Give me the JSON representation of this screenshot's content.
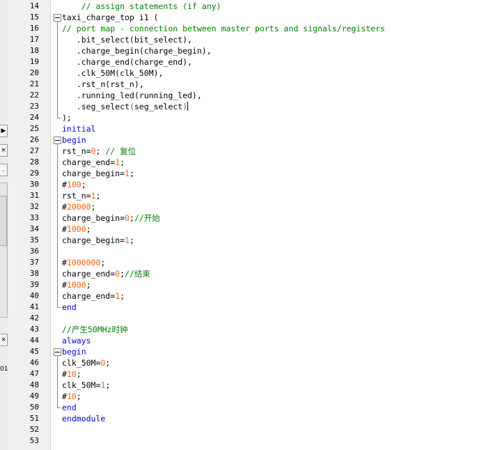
{
  "left_panel": {
    "button_arrow": "▶",
    "button_close_1": "×",
    "button_dot": ".",
    "button_close_2": "×",
    "fragment_text": "01"
  },
  "editor": {
    "lines": [
      {
        "n": "14",
        "tokens": [
          {
            "t": "    // assign statements (if any)",
            "c": "cm"
          }
        ]
      },
      {
        "n": "15",
        "fold": true,
        "tokens": [
          {
            "t": "taxi_charge_top i1 (",
            "c": "tx"
          }
        ]
      },
      {
        "n": "16",
        "tokens": [
          {
            "t": "// port map - connection between master ports and signals/registers",
            "c": "cm"
          }
        ]
      },
      {
        "n": "17",
        "tokens": [
          {
            "t": "   .bit_select(bit_select),",
            "c": "tx"
          }
        ]
      },
      {
        "n": "18",
        "tokens": [
          {
            "t": "   .charge_begin(charge_begin),",
            "c": "tx"
          }
        ]
      },
      {
        "n": "19",
        "tokens": [
          {
            "t": "   .charge_end(charge_end),",
            "c": "tx"
          }
        ]
      },
      {
        "n": "20",
        "tokens": [
          {
            "t": "   .clk_50M(clk_50M),",
            "c": "tx"
          }
        ]
      },
      {
        "n": "21",
        "tokens": [
          {
            "t": "   .rst_n(rst_n),",
            "c": "tx"
          }
        ]
      },
      {
        "n": "22",
        "tokens": [
          {
            "t": "   .running_led(running_led),",
            "c": "tx"
          }
        ]
      },
      {
        "n": "23",
        "caret": true,
        "tokens": [
          {
            "t": "   .seg_select",
            "c": "tx"
          },
          {
            "t": "(",
            "c": "pn"
          },
          {
            "t": "seg_select",
            "c": "tx"
          },
          {
            "t": ")",
            "c": "pn"
          }
        ]
      },
      {
        "n": "24",
        "tokens": [
          {
            "t": ");",
            "c": "tx"
          }
        ]
      },
      {
        "n": "25",
        "tokens": [
          {
            "t": "initial",
            "c": "kw"
          }
        ]
      },
      {
        "n": "26",
        "fold": true,
        "tokens": [
          {
            "t": "begin",
            "c": "kw"
          }
        ]
      },
      {
        "n": "27",
        "tokens": [
          {
            "t": "rst_n=",
            "c": "tx"
          },
          {
            "t": "0",
            "c": "num"
          },
          {
            "t": "; ",
            "c": "tx"
          },
          {
            "t": "// 复位",
            "c": "cm"
          }
        ]
      },
      {
        "n": "28",
        "tokens": [
          {
            "t": "charge_end=",
            "c": "tx"
          },
          {
            "t": "1",
            "c": "num"
          },
          {
            "t": ";",
            "c": "tx"
          }
        ]
      },
      {
        "n": "29",
        "tokens": [
          {
            "t": "charge_begin=",
            "c": "tx"
          },
          {
            "t": "1",
            "c": "num"
          },
          {
            "t": ";",
            "c": "tx"
          }
        ]
      },
      {
        "n": "30",
        "tokens": [
          {
            "t": "#",
            "c": "tx"
          },
          {
            "t": "100",
            "c": "num"
          },
          {
            "t": ";",
            "c": "tx"
          }
        ]
      },
      {
        "n": "31",
        "tokens": [
          {
            "t": "rst_n=",
            "c": "tx"
          },
          {
            "t": "1",
            "c": "num"
          },
          {
            "t": ";",
            "c": "tx"
          }
        ]
      },
      {
        "n": "32",
        "tokens": [
          {
            "t": "#",
            "c": "tx"
          },
          {
            "t": "20000",
            "c": "num"
          },
          {
            "t": ";",
            "c": "tx"
          }
        ]
      },
      {
        "n": "33",
        "tokens": [
          {
            "t": "charge_begin=",
            "c": "tx"
          },
          {
            "t": "0",
            "c": "num"
          },
          {
            "t": ";",
            "c": "tx"
          },
          {
            "t": "//开始",
            "c": "cm"
          }
        ]
      },
      {
        "n": "34",
        "tokens": [
          {
            "t": "#",
            "c": "tx"
          },
          {
            "t": "1000",
            "c": "num"
          },
          {
            "t": ";",
            "c": "tx"
          }
        ]
      },
      {
        "n": "35",
        "tokens": [
          {
            "t": "charge_begin=",
            "c": "tx"
          },
          {
            "t": "1",
            "c": "num"
          },
          {
            "t": ";",
            "c": "tx"
          }
        ]
      },
      {
        "n": "36",
        "tokens": []
      },
      {
        "n": "37",
        "tokens": [
          {
            "t": "#",
            "c": "tx"
          },
          {
            "t": "1000000",
            "c": "num"
          },
          {
            "t": ";",
            "c": "tx"
          }
        ]
      },
      {
        "n": "38",
        "tokens": [
          {
            "t": "charge_end=",
            "c": "tx"
          },
          {
            "t": "0",
            "c": "num"
          },
          {
            "t": ";",
            "c": "tx"
          },
          {
            "t": "//结束",
            "c": "cm"
          }
        ]
      },
      {
        "n": "39",
        "tokens": [
          {
            "t": "#",
            "c": "tx"
          },
          {
            "t": "1000",
            "c": "num"
          },
          {
            "t": ";",
            "c": "tx"
          }
        ]
      },
      {
        "n": "40",
        "tokens": [
          {
            "t": "charge_end=",
            "c": "tx"
          },
          {
            "t": "1",
            "c": "num"
          },
          {
            "t": ";",
            "c": "tx"
          }
        ]
      },
      {
        "n": "41",
        "tokens": [
          {
            "t": "end",
            "c": "kw"
          }
        ]
      },
      {
        "n": "42",
        "tokens": []
      },
      {
        "n": "43",
        "tokens": [
          {
            "t": "//产生50MHz时钟",
            "c": "cm"
          }
        ]
      },
      {
        "n": "44",
        "tokens": [
          {
            "t": "always",
            "c": "kw"
          }
        ]
      },
      {
        "n": "45",
        "fold": true,
        "tokens": [
          {
            "t": "begin",
            "c": "kw"
          }
        ]
      },
      {
        "n": "46",
        "tokens": [
          {
            "t": "clk_50M=",
            "c": "tx"
          },
          {
            "t": "0",
            "c": "num"
          },
          {
            "t": ";",
            "c": "tx"
          }
        ]
      },
      {
        "n": "47",
        "tokens": [
          {
            "t": "#",
            "c": "tx"
          },
          {
            "t": "10",
            "c": "num"
          },
          {
            "t": ";",
            "c": "tx"
          }
        ]
      },
      {
        "n": "48",
        "tokens": [
          {
            "t": "clk_50M=",
            "c": "tx"
          },
          {
            "t": "1",
            "c": "num"
          },
          {
            "t": ";",
            "c": "tx"
          }
        ]
      },
      {
        "n": "49",
        "tokens": [
          {
            "t": "#",
            "c": "tx"
          },
          {
            "t": "10",
            "c": "num"
          },
          {
            "t": ";",
            "c": "tx"
          }
        ]
      },
      {
        "n": "50",
        "tokens": [
          {
            "t": "end",
            "c": "kw"
          }
        ]
      },
      {
        "n": "51",
        "tokens": [
          {
            "t": "endmodule",
            "c": "kw"
          }
        ]
      },
      {
        "n": "52",
        "tokens": []
      },
      {
        "n": "53",
        "tokens": []
      }
    ]
  }
}
